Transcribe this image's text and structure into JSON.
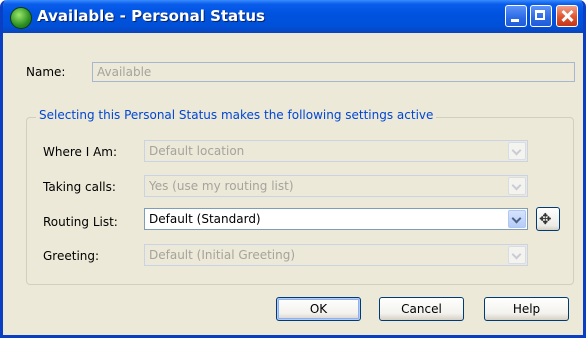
{
  "window": {
    "title": "Available - Personal Status"
  },
  "name": {
    "label": "Name:",
    "value": "Available"
  },
  "group": {
    "title": "Selecting this Personal Status makes the following settings active"
  },
  "fields": [
    {
      "label": "Where I Am:",
      "value": "Default location"
    },
    {
      "label": "Taking calls:",
      "value": "Yes (use my routing list)"
    },
    {
      "label": "Routing List:",
      "value": "Default (Standard)"
    },
    {
      "label": "Greeting:",
      "value": "Default (Initial Greeting)"
    }
  ],
  "buttons": {
    "ok": "OK",
    "cancel": "Cancel",
    "help": "Help"
  },
  "routing_button_icon": "routing-globe-icon",
  "colors": {
    "title_bar": "#0053E0",
    "group_title": "#0046D5",
    "dialog_bg": "#ECE9D8"
  }
}
